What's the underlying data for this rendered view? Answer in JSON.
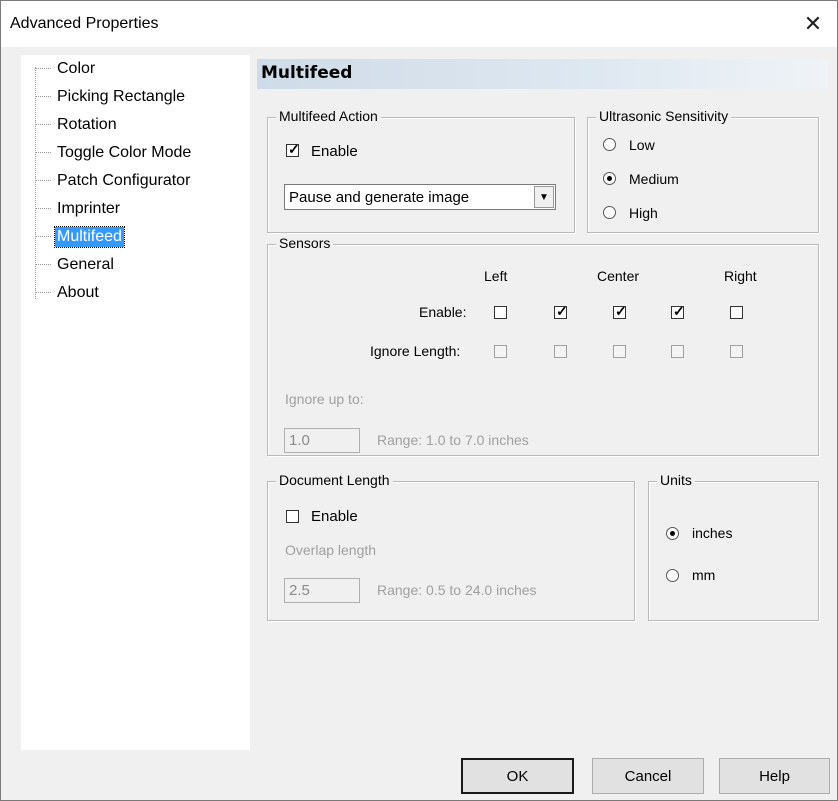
{
  "window": {
    "title": "Advanced Properties",
    "close_glyph": "✕"
  },
  "tree": {
    "items": [
      "Color",
      "Picking Rectangle",
      "Rotation",
      "Toggle Color Mode",
      "Patch Configurator",
      "Imprinter",
      "Multifeed",
      "General",
      "About"
    ],
    "selected": "Multifeed"
  },
  "page": {
    "header": "Multifeed"
  },
  "multifeed_action": {
    "title": "Multifeed Action",
    "enable_label": "Enable",
    "enable_checked": true,
    "action_select": "Pause and generate image"
  },
  "ultrasonic": {
    "title": "Ultrasonic Sensitivity",
    "options": [
      "Low",
      "Medium",
      "High"
    ],
    "selected": "Medium"
  },
  "sensors": {
    "title": "Sensors",
    "columns": [
      "Left",
      "Center",
      "Right"
    ],
    "enable_label": "Enable:",
    "enable_values": [
      false,
      true,
      true,
      true,
      false
    ],
    "ignore_length_label": "Ignore Length:",
    "ignore_length_values": [
      false,
      false,
      false,
      false,
      false
    ],
    "ignore_up_to_label": "Ignore up to:",
    "ignore_up_to_value": "1.0",
    "range_label": "Range: 1.0 to 7.0 inches"
  },
  "document_length": {
    "title": "Document Length",
    "enable_label": "Enable",
    "enable_checked": false,
    "overlap_label": "Overlap length",
    "overlap_value": "2.5",
    "range_label": "Range: 0.5 to 24.0 inches"
  },
  "units": {
    "title": "Units",
    "options": [
      "inches",
      "mm"
    ],
    "selected": "inches"
  },
  "buttons": {
    "ok": "OK",
    "cancel": "Cancel",
    "help": "Help"
  }
}
